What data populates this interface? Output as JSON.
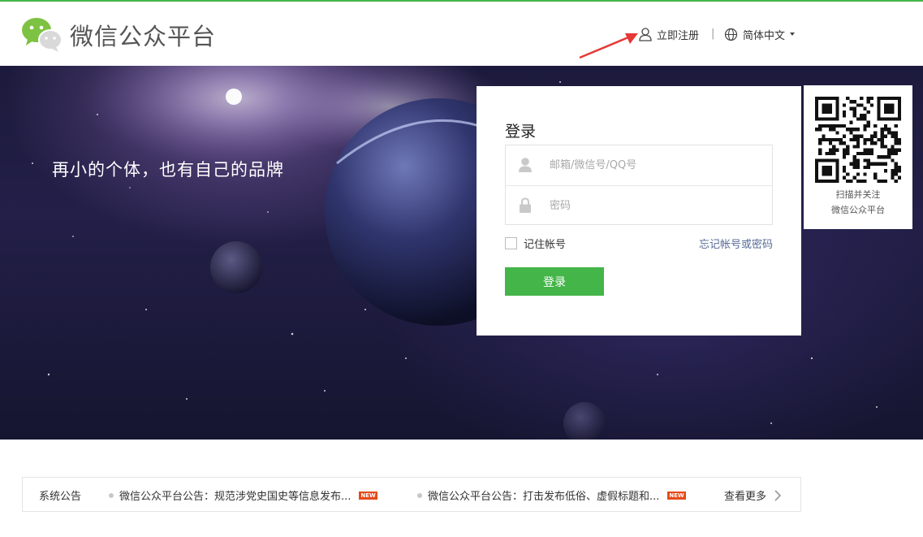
{
  "header": {
    "brand": "微信公众平台",
    "register_label": "立即注册",
    "separator": "|",
    "language_label": "简体中文"
  },
  "banner": {
    "slogan": "再小的个体，也有自己的品牌"
  },
  "login": {
    "title": "登录",
    "account_placeholder": "邮箱/微信号/QQ号",
    "account_value": "",
    "password_placeholder": "密码",
    "password_value": "",
    "remember_label": "记住帐号",
    "remember_checked": false,
    "forgot_label": "忘记帐号或密码",
    "submit_label": "登录"
  },
  "qr": {
    "line1": "扫描并关注",
    "line2": "微信公众平台"
  },
  "notice": {
    "label": "系统公告",
    "items": [
      {
        "text": "微信公众平台公告：规范涉党史国史等信息发布...",
        "badge": "NEW"
      },
      {
        "text": "微信公众平台公告：打击发布低俗、虚假标题和...",
        "badge": "NEW"
      }
    ],
    "more_label": "查看更多"
  },
  "colors": {
    "brand_green": "#44b549",
    "link_blue": "#576b95",
    "badge_red": "#e64a19",
    "annotation_arrow": "#e53935"
  },
  "icons": {
    "logo": "wechat-logo-icon",
    "register": "user-icon",
    "language": "globe-icon",
    "account": "user-icon",
    "password": "lock-icon",
    "more": "chevron-right-icon"
  }
}
